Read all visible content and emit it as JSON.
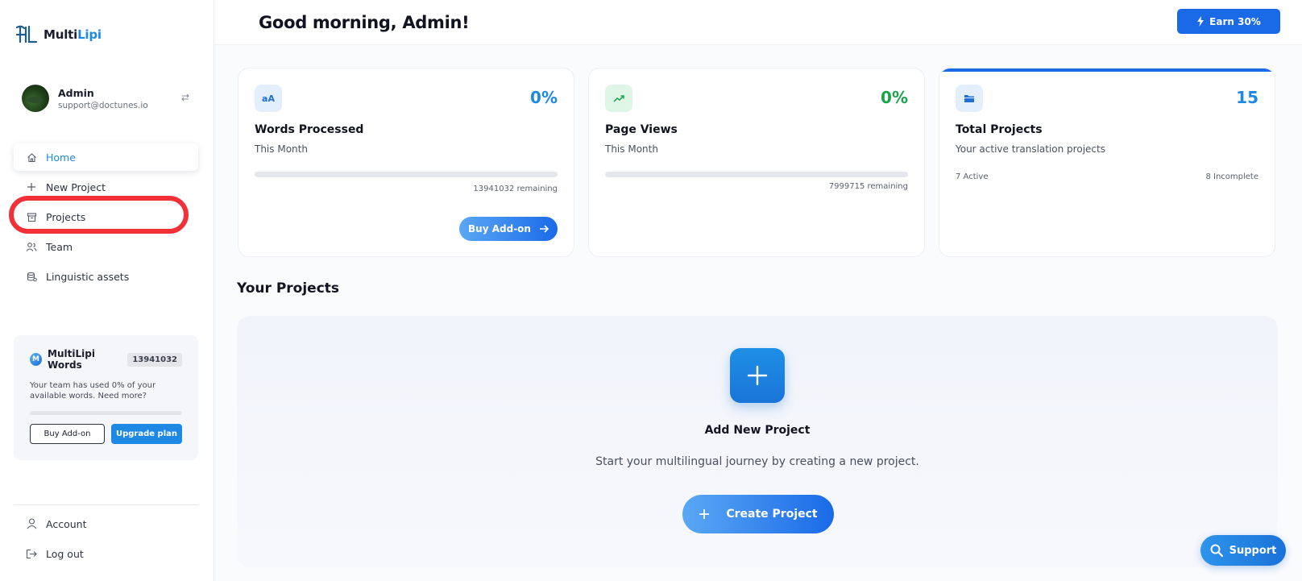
{
  "brand": {
    "name_part1": "Multi",
    "name_part2": "Lipi"
  },
  "user": {
    "name": "Admin",
    "email": "support@doctunes.io"
  },
  "nav": {
    "items": [
      {
        "label": "Home",
        "icon": "home-icon",
        "active": true
      },
      {
        "label": "New Project",
        "icon": "plus-icon"
      },
      {
        "label": "Projects",
        "icon": "archive-icon"
      },
      {
        "label": "Team",
        "icon": "users-icon"
      },
      {
        "label": "Linguistic assets",
        "icon": "database-icon"
      }
    ]
  },
  "words_card": {
    "title": "MultiLipi Words",
    "badge_letter": "M",
    "count": "13941032",
    "text": "Your team has used 0% of your available words. Need more?",
    "usage_fraction": 0,
    "buy_label": "Buy Add-on",
    "upgrade_label": "Upgrade plan"
  },
  "bottom_nav": [
    {
      "label": "Account",
      "icon": "user-icon"
    },
    {
      "label": "Log out",
      "icon": "logout-icon"
    }
  ],
  "header": {
    "greeting": "Good morning, Admin!",
    "earn_label": "Earn 30%"
  },
  "stats": {
    "words": {
      "icon_text": "aA",
      "value": "0%",
      "title": "Words Processed",
      "sub": "This Month",
      "remaining": "13941032 remaining",
      "progress": 0,
      "buy_label": "Buy Add-on"
    },
    "views": {
      "value": "0%",
      "title": "Page Views",
      "sub": "This Month",
      "remaining": "7999715 remaining",
      "progress": 0
    },
    "projects": {
      "value": "15",
      "title": "Total Projects",
      "sub": "Your active translation projects",
      "active": "7 Active",
      "incomplete": "8 Incomplete"
    }
  },
  "projects": {
    "section_title": "Your Projects",
    "add_title": "Add New Project",
    "add_sub": "Start your multilingual journey by creating a new project.",
    "create_label": "Create Project"
  },
  "support": {
    "label": "Support"
  },
  "colors": {
    "accent": "#1e88e5",
    "primary_button": "#1a6ae8",
    "green": "#1aa34a",
    "highlight": "#f23037"
  }
}
